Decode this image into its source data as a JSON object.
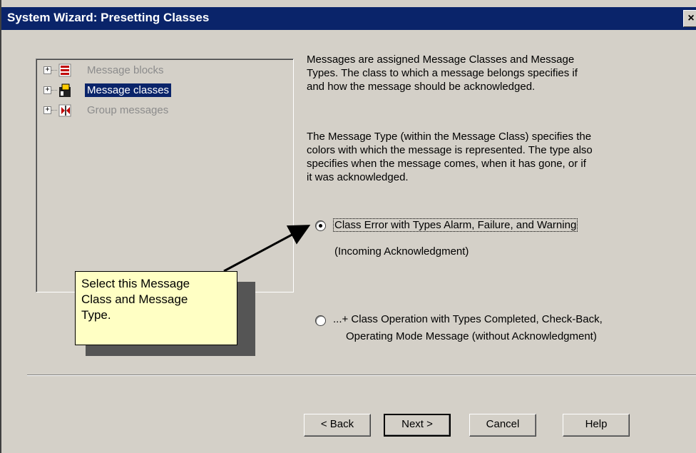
{
  "window": {
    "title": "System Wizard: Presetting Classes",
    "close_label": "×"
  },
  "tree": {
    "items": [
      {
        "label": "Message blocks",
        "state": "disabled",
        "icon": "message-blocks-icon"
      },
      {
        "label": "Message classes",
        "state": "selected",
        "icon": "message-classes-icon"
      },
      {
        "label": "Group messages",
        "state": "disabled",
        "icon": "group-messages-icon"
      }
    ]
  },
  "description": {
    "paragraph1": [
      "Messages are assigned Message Classes and Message",
      "Types. The class to which a message belongs specifies if",
      "and how the message should be acknowledged."
    ],
    "paragraph2": [
      "The Message Type (within the Message Class) specifies the",
      "colors with which the message is represented. The type also",
      "specifies when the message comes, when it has gone, or if",
      "it was acknowledged."
    ]
  },
  "options": {
    "option1_line1": "Class Error with Types Alarm, Failure, and Warning",
    "option1_line2": "(Incoming Acknowledgment)",
    "option1_selected": true,
    "option2_line1": "...+ Class Operation with Types Completed, Check-Back,",
    "option2_line2": "Operating Mode Message (without Acknowledgment)",
    "option2_selected": false
  },
  "callout": {
    "lines": [
      "Select this Message",
      "Class and Message",
      "Type."
    ]
  },
  "buttons": {
    "back": "< Back",
    "next": "Next >",
    "cancel": "Cancel",
    "help": "Help"
  },
  "colors": {
    "titlebar": "#0a246a",
    "dialog_bg": "#d4d0c8",
    "callout_bg": "#ffffc4",
    "selection": "#0a246a"
  }
}
